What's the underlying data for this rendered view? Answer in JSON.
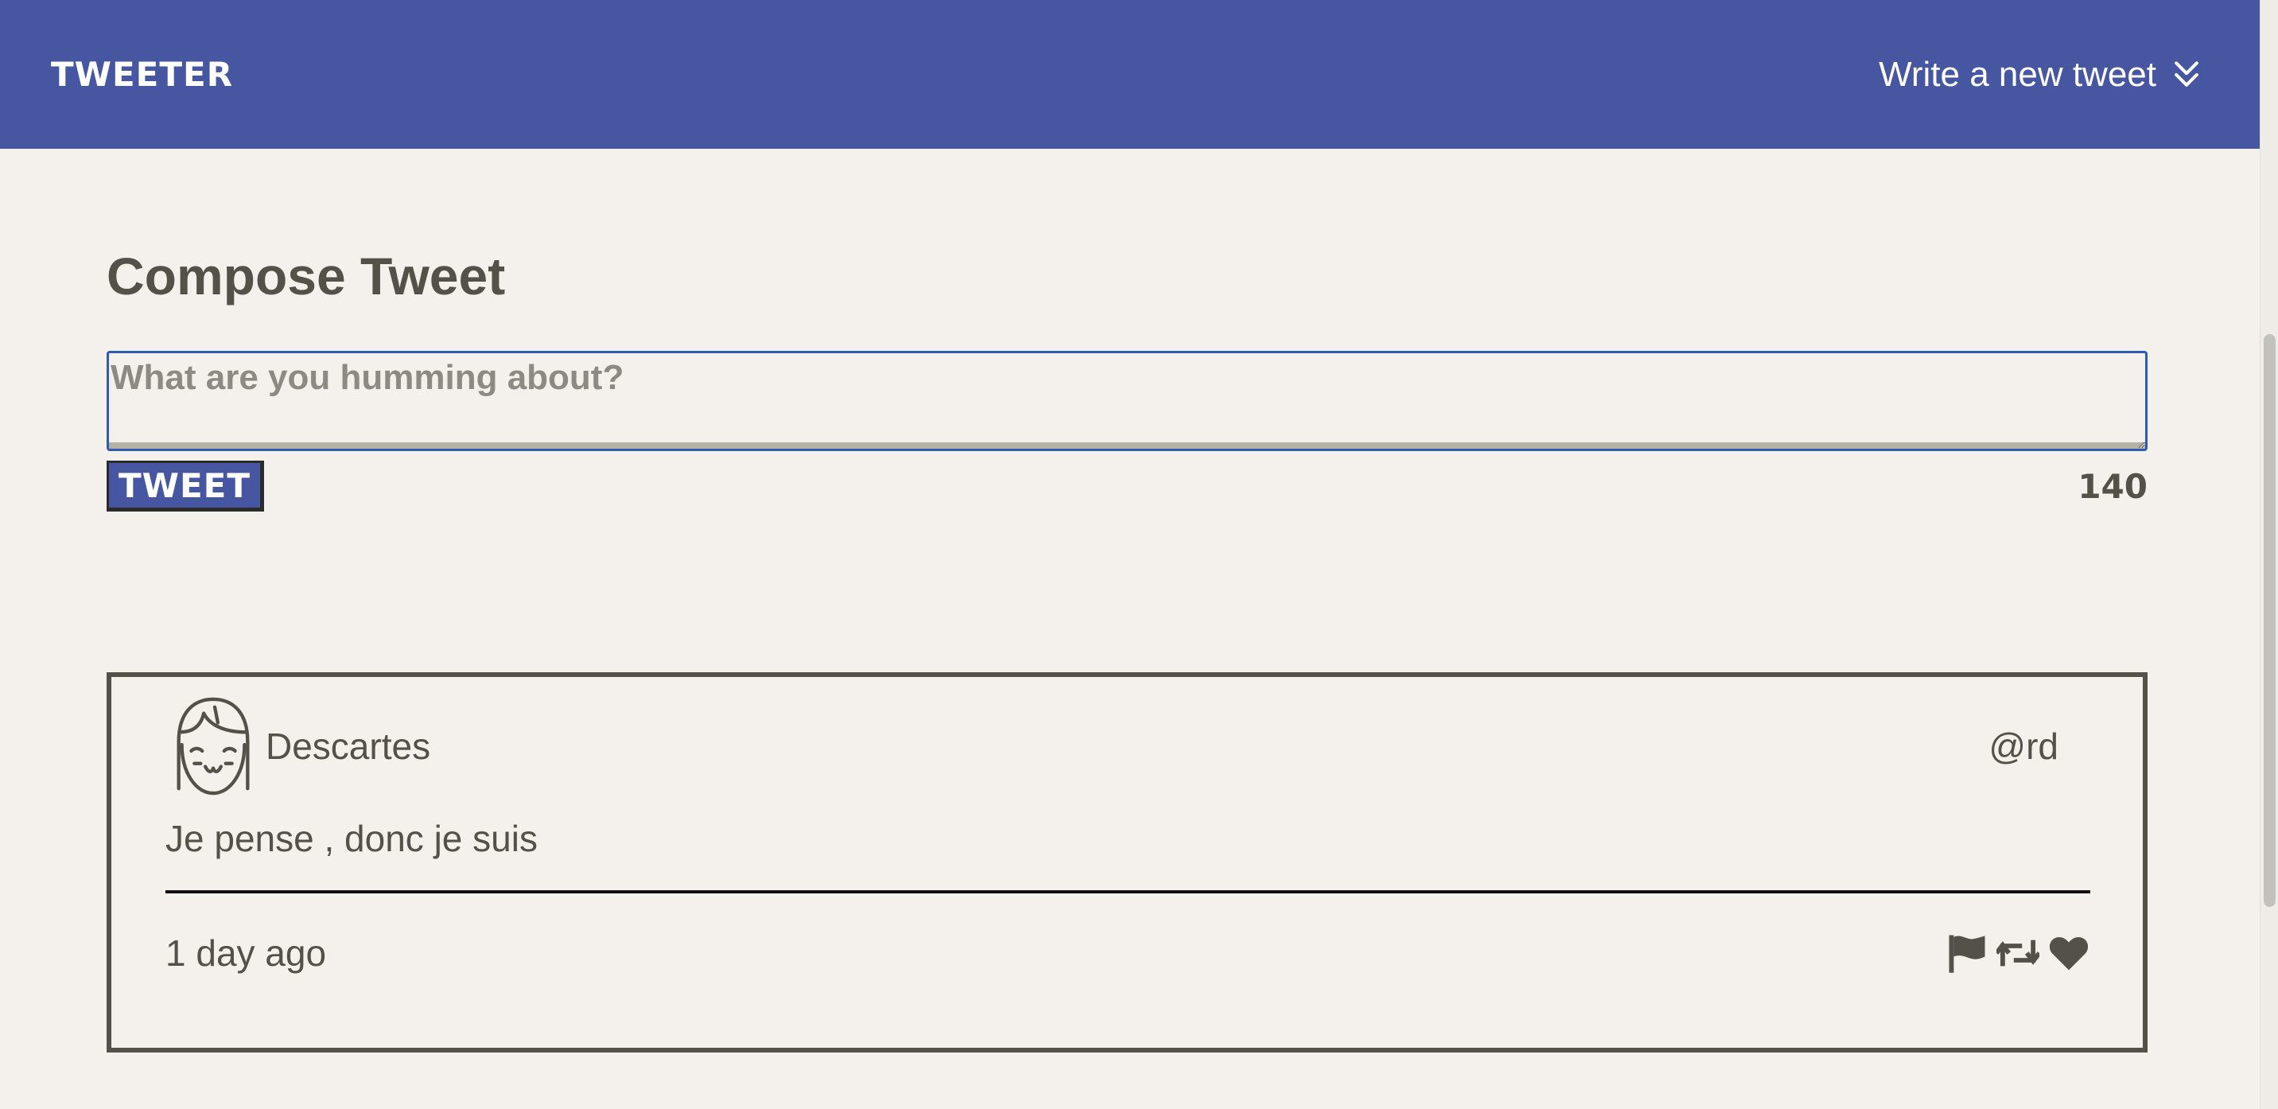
{
  "nav": {
    "brand": "TWEETER",
    "compose_link": "Write a new tweet",
    "compose_link_icon": "double-chevron-down-icon"
  },
  "compose": {
    "title": "Compose Tweet",
    "placeholder": "What are you humming about?",
    "value": "",
    "button_label": "TWEET",
    "char_counter": "140"
  },
  "tweets": [
    {
      "author_name": "Descartes",
      "handle": "@rd",
      "avatar_icon": "girl-face-avatar-icon",
      "text": "Je pense , donc je suis",
      "timestamp": "1 day ago",
      "actions": [
        "flag-icon",
        "retweet-icon",
        "heart-icon"
      ]
    }
  ],
  "colors": {
    "nav_bg": "#4656a0",
    "page_bg": "#f4f1ec",
    "text": "#545149",
    "input_focus_border": "#2f5bb3"
  }
}
